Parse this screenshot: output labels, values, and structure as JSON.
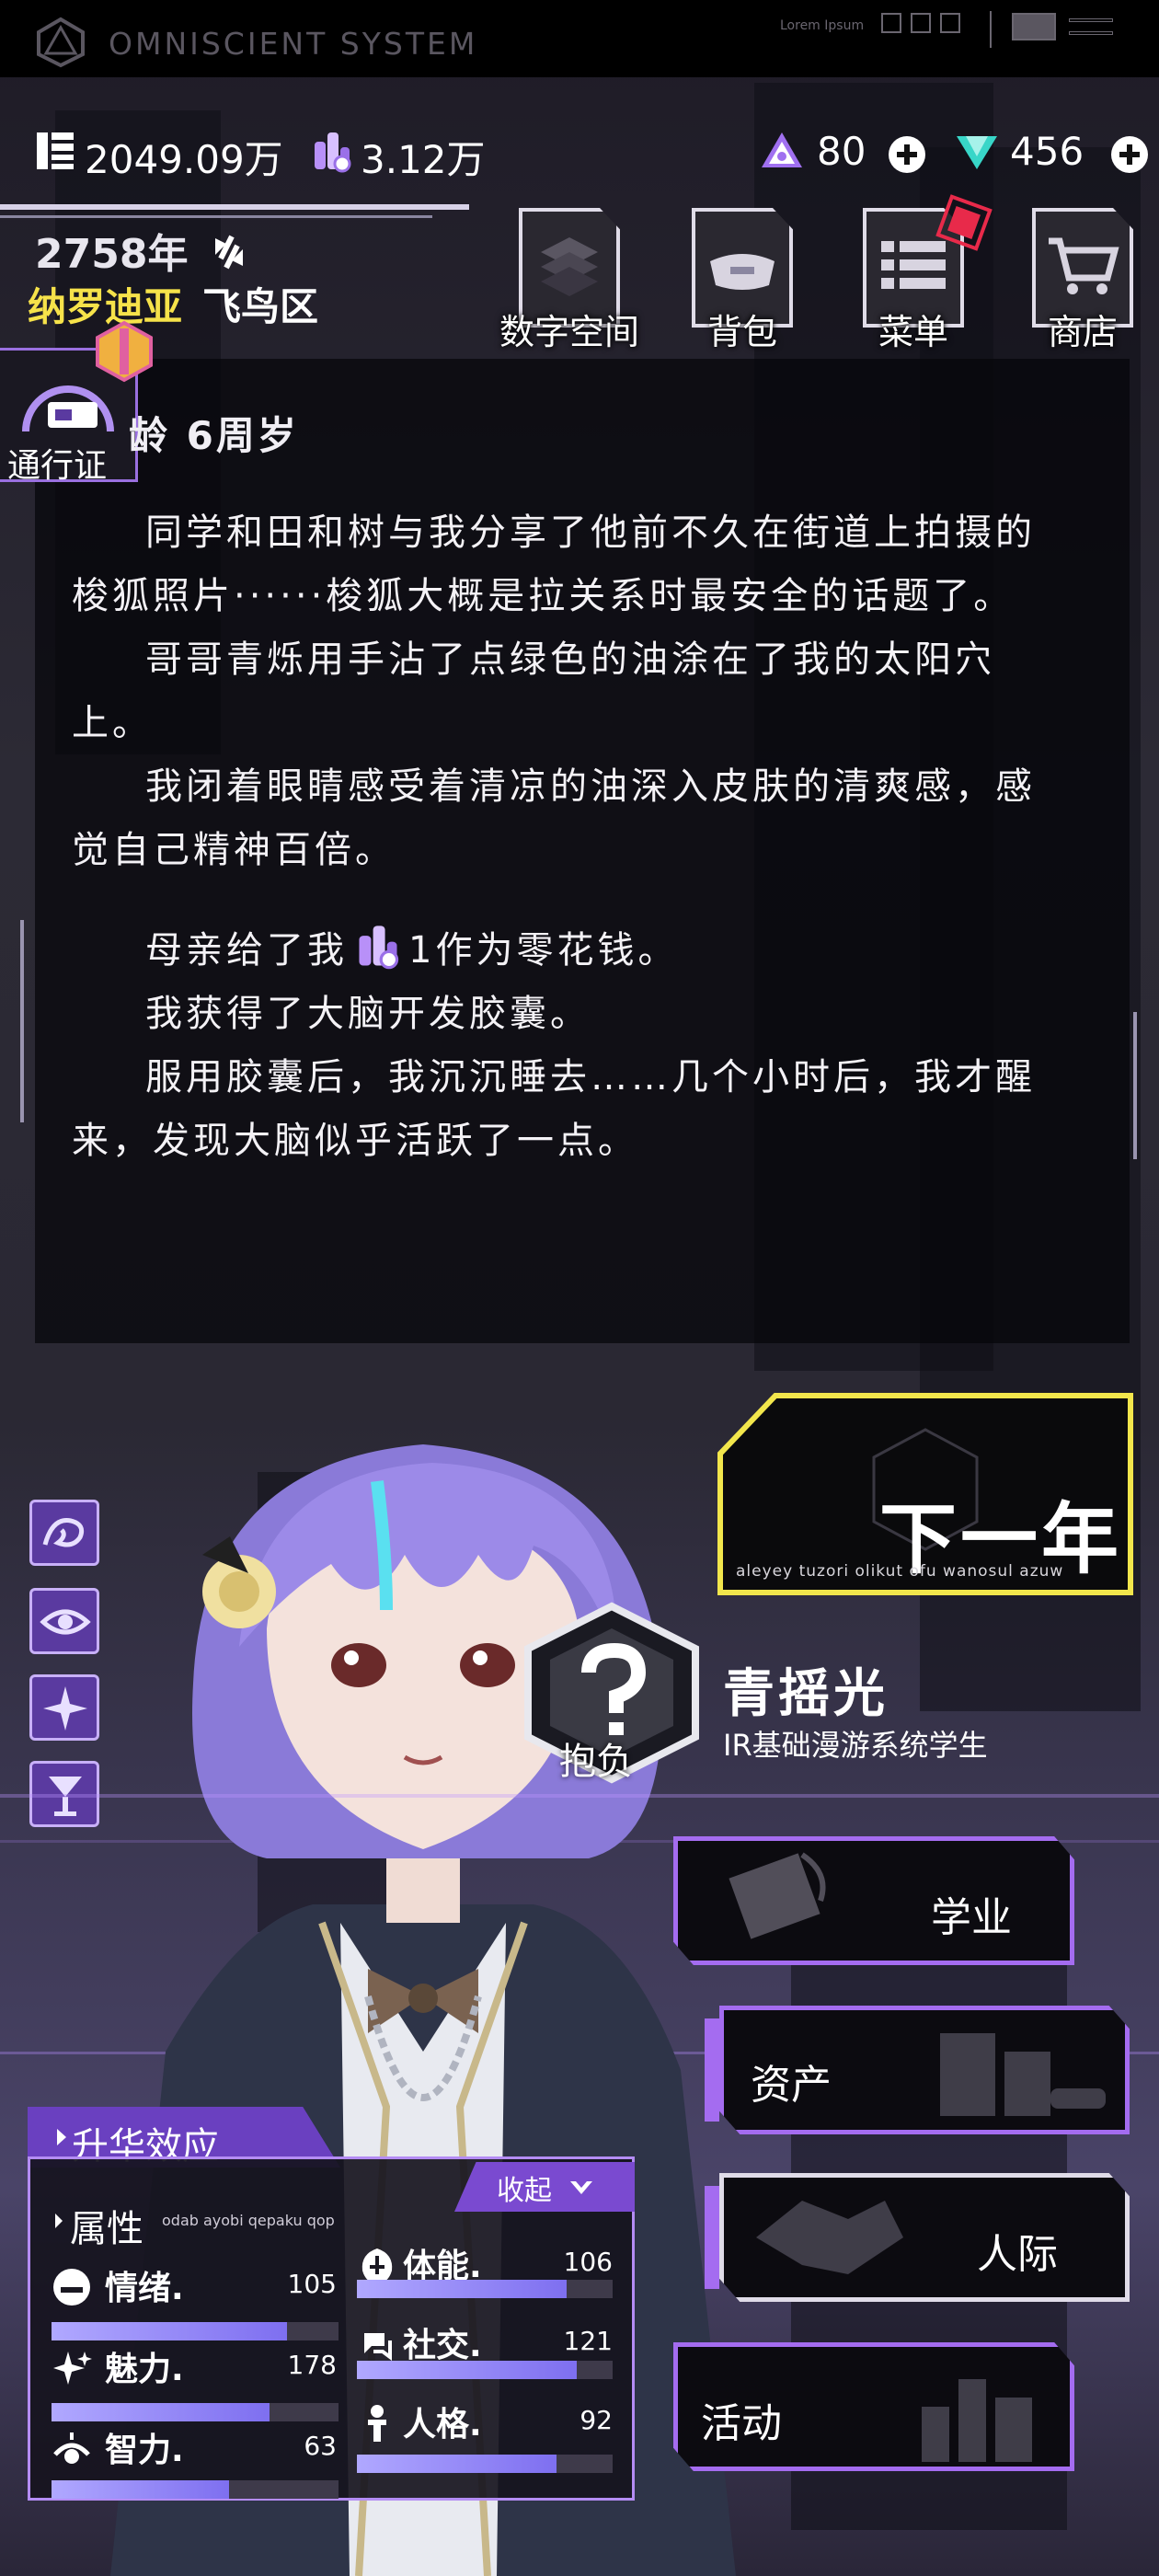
{
  "topbar": {
    "title": "OMNISCIENT SYSTEM",
    "deco_text": "Lorem Ipsum"
  },
  "resources": {
    "money": "2049.09万",
    "currency2": "3.12万",
    "gems": "80",
    "crystals": "456"
  },
  "location": {
    "year": "2758年",
    "city": "纳罗迪亚",
    "district": "飞鸟区"
  },
  "menu": [
    {
      "label": "数字空间",
      "icon": "digital-space-icon"
    },
    {
      "label": "背包",
      "icon": "bag-icon"
    },
    {
      "label": "菜单",
      "icon": "menu-icon"
    },
    {
      "label": "商店",
      "icon": "cart-icon"
    }
  ],
  "pass": {
    "label": "通行证"
  },
  "story": {
    "age": "龄 6周岁",
    "p1": "同学和田和树与我分享了他前不久在街道上拍摄的梭狐照片······梭狐大概是拉关系时最安全的话题了。",
    "p2": "哥哥青烁用手沾了点绿色的油涂在了我的太阳穴上。",
    "p3": "我闭着眼睛感受着清凉的油深入皮肤的清爽感，感觉自己精神百倍。",
    "p4_a": "母亲给了我",
    "p4_b": "1作为零花钱。",
    "p5": "我获得了大脑开发胶囊。",
    "p6": "服用胶囊后，我沉沉睡去……几个小时后，我才醒来，发现大脑似乎活跃了一点。"
  },
  "next_year": {
    "label": "下一年",
    "sub": "aleyey tuzori olikut ofu wanosul azuw"
  },
  "character": {
    "badge_label": "抱负",
    "name": "青摇光",
    "title": "IR基础漫游系统学生"
  },
  "actions": [
    {
      "label": "学业"
    },
    {
      "label": "资产"
    },
    {
      "label": "人际"
    },
    {
      "label": "活动"
    }
  ],
  "effects": {
    "tab_label": "升华效应"
  },
  "attributes": {
    "title": "属性",
    "subtitle": "odab ayobi qepaku qop",
    "collapse_label": "收起",
    "stats": [
      {
        "name": "情绪.",
        "value": "105",
        "ratio": 0.82
      },
      {
        "name": "魅力.",
        "value": "178",
        "ratio": 0.76
      },
      {
        "name": "智力.",
        "value": "63",
        "ratio": 0.62
      },
      {
        "name": "体能.",
        "value": "106",
        "ratio": 0.82
      },
      {
        "name": "社交.",
        "value": "121",
        "ratio": 0.86
      },
      {
        "name": "人格.",
        "value": "92",
        "ratio": 0.78
      }
    ]
  },
  "colors": {
    "accent": "#a46cf0",
    "highlight": "#f6e24a",
    "next_border": "#f2e64c"
  }
}
